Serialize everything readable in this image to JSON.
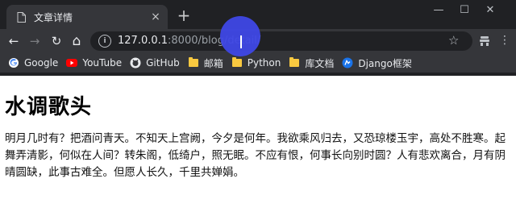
{
  "tab": {
    "title": "文章详情",
    "close": "×",
    "new_tab": "+"
  },
  "window_controls": {
    "minimize": "—",
    "maximize": "☐",
    "close": "✕"
  },
  "toolbar": {
    "back": "←",
    "forward": "→",
    "reload": "↻",
    "home": "⌂"
  },
  "address": {
    "host": "127.0.0.1",
    "path": ":8000/blog/detail/"
  },
  "bookmarks": [
    {
      "label": "Google",
      "icon": "google-icon",
      "color": "#4285f4"
    },
    {
      "label": "YouTube",
      "icon": "youtube-icon",
      "color": "#ff0000"
    },
    {
      "label": "GitHub",
      "icon": "github-icon",
      "color": "#ffffff"
    },
    {
      "label": "邮箱",
      "icon": "folder-icon",
      "color": "#f9c940"
    },
    {
      "label": "Python",
      "icon": "folder-icon",
      "color": "#f9c940"
    },
    {
      "label": "库文档",
      "icon": "folder-icon",
      "color": "#f9c940"
    },
    {
      "label": "Django框架",
      "icon": "django-icon",
      "color": "#1a73e8"
    }
  ],
  "article": {
    "title": "水调歌头",
    "body": "明月几时有？把酒问青天。不知天上宫阙，今夕是何年。我欲乘风归去，又恐琼楼玉宇，高处不胜寒。起舞弄清影，何似在人间？转朱阁，低绮户，照无眠。不应有恨，何事长向别时圆？人有悲欢离合，月有阴晴圆缺，此事古难全。但愿人长久，千里共婵娟。"
  }
}
